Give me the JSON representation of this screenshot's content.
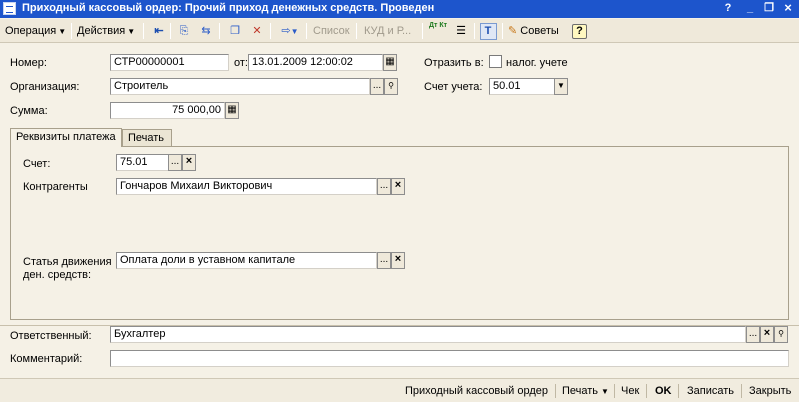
{
  "window": {
    "title": "Приходный кассовый ордер: Прочий приход денежных средств. Проведен",
    "controls": {
      "help": "?",
      "minimize": "_",
      "restore": "❐",
      "close": "×"
    }
  },
  "toolbar": {
    "operation": "Операция",
    "actions": "Действия",
    "list": "Список",
    "kud": "КУД и Р...",
    "advice": "Советы",
    "help": "?",
    "dtkt": "Дт Кт",
    "icons": [
      "enter-arrow-icon",
      "refresh-doc-icon",
      "swap-doc-icon",
      "copy-doc-icon",
      "delete-doc-icon",
      "create-based-icon",
      "dtkt-icon",
      "journal-icon",
      "structure-icon",
      "advice-icon",
      "help-icon"
    ]
  },
  "form": {
    "number_label": "Номер:",
    "number_value": "СТР00000001",
    "date_label": "от:",
    "date_value": "13.01.2009 12:00:02",
    "reflect_label": "Отразить в:",
    "tax_label": "налог. учете",
    "tax_checked": false,
    "org_label": "Организация:",
    "org_value": "Строитель",
    "account_label": "Счет учета:",
    "account_value": "50.01",
    "sum_label": "Сумма:",
    "sum_value": "75 000,00"
  },
  "tabs": [
    {
      "label": "Реквизиты платежа",
      "active": true
    },
    {
      "label": "Печать",
      "active": false
    }
  ],
  "payment": {
    "account_label": "Счет:",
    "account_value": "75.01",
    "contractor_label": "Контрагенты",
    "contractor_value": "Гончаров Михаил Викторович",
    "cashflow_label_1": "Статья движения",
    "cashflow_label_2": "ден. средств:",
    "cashflow_value": "Оплата доли в уставном капитале"
  },
  "footer_fields": {
    "responsible_label": "Ответственный:",
    "responsible_value": "Бухгалтер",
    "comment_label": "Комментарий:",
    "comment_value": ""
  },
  "bottom": {
    "order": "Приходный кассовый ордер",
    "print": "Печать",
    "check": "Чек",
    "ok": "OK",
    "save": "Записать",
    "close": "Закрыть"
  },
  "buttons": {
    "select": "...",
    "clear": "×",
    "open": "🔍",
    "dropdown": "▼",
    "calc": "▦",
    "calendar": "▦"
  }
}
